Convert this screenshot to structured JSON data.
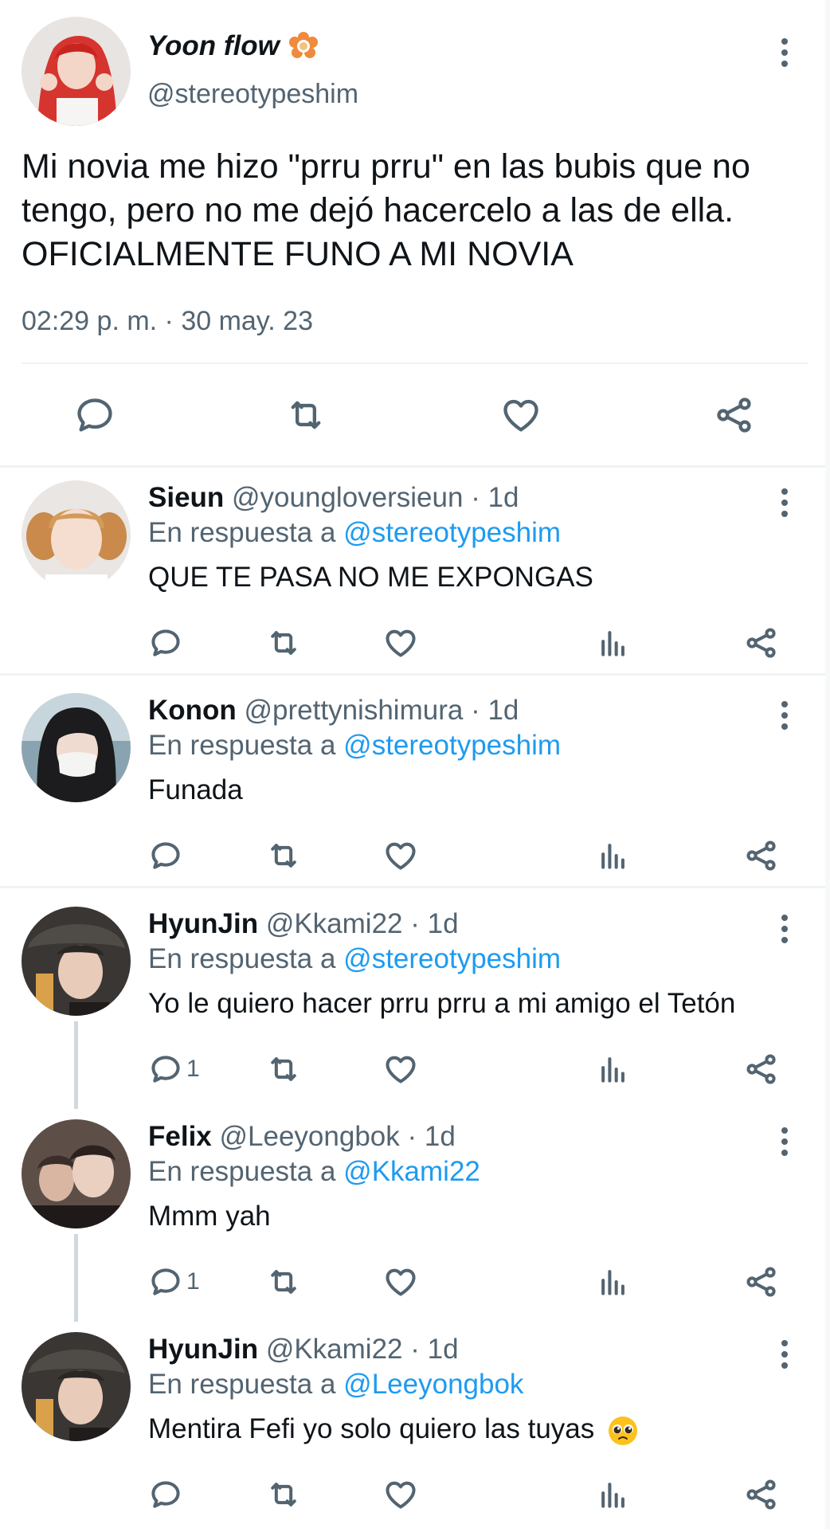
{
  "main_tweet": {
    "author_name": "Yoon flow",
    "author_handle": "@stereotypeshim",
    "text_lines": [
      "Mi novia me hizo \"prru prru\" en las bubis que no",
      "tengo, pero no me dejó hacercelo a las de ella.",
      "OFICIALMENTE FUNO A MI NOVIA"
    ],
    "timestamp": "02:29 p. m. · 30 may. 23",
    "actions": [
      "reply-icon",
      "retweet-icon",
      "like-icon",
      "share-icon"
    ]
  },
  "replies": [
    {
      "name": "Sieun",
      "handle": "@youngloversieun",
      "dot": "·",
      "time": "1d",
      "reply_prefix": "En respuesta a",
      "reply_to": "@stereotypeshim",
      "text": "QUE TE PASA NO ME EXPONGAS",
      "reply_count": "",
      "emoji": ""
    },
    {
      "name": "Konon",
      "handle": "@prettynishimura",
      "dot": "·",
      "time": "1d",
      "reply_prefix": "En respuesta a",
      "reply_to": "@stereotypeshim",
      "text": "Funada",
      "reply_count": "",
      "emoji": ""
    },
    {
      "name": "HyunJin",
      "handle": "@Kkami22",
      "dot": "·",
      "time": "1d",
      "reply_prefix": "En respuesta a",
      "reply_to": "@stereotypeshim",
      "text": "Yo le quiero hacer prru prru a mi amigo el Tetón",
      "reply_count": "1",
      "emoji": ""
    },
    {
      "name": "Felix",
      "handle": "@Leeyongbok",
      "dot": "·",
      "time": "1d",
      "reply_prefix": "En respuesta a",
      "reply_to": "@Kkami22",
      "text": "Mmm yah",
      "reply_count": "1",
      "emoji": ""
    },
    {
      "name": "HyunJin",
      "handle": "@Kkami22",
      "dot": "·",
      "time": "1d",
      "reply_prefix": "En respuesta a",
      "reply_to": "@Leeyongbok",
      "text": "Mentira Fefi yo solo quiero las tuyas",
      "reply_count": "",
      "emoji": "pleading-face-emoji"
    }
  ],
  "colors": {
    "text": "#0f1419",
    "secondary": "#536471",
    "link": "#1d9bf0",
    "divider": "#eff3f4",
    "thread_line": "#cfd9de"
  }
}
